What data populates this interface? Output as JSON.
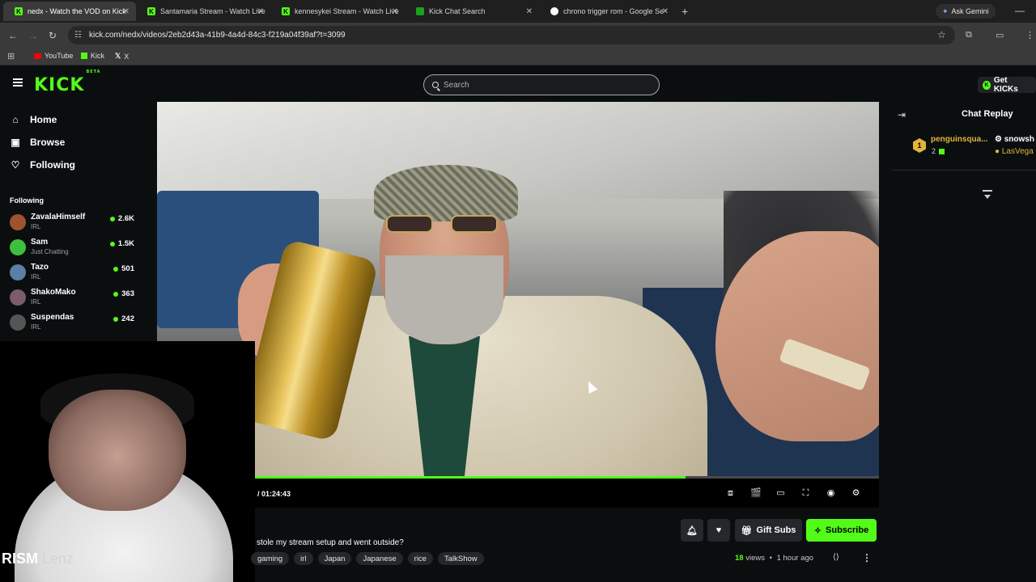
{
  "browser": {
    "tabs": [
      {
        "title": "nedx - Watch the VOD on Kick",
        "icon": "kick-icon"
      },
      {
        "title": "Santamaria Stream - Watch Live",
        "icon": "kick-icon"
      },
      {
        "title": "kennesykei Stream - Watch Live",
        "icon": "kick-icon"
      },
      {
        "title": "Kick Chat Search",
        "icon": "kick-chat-icon"
      },
      {
        "title": "chrono trigger rom - Google Se",
        "icon": "google-icon"
      }
    ],
    "new_tab": "+",
    "ask_gemini": "Ask Gemini",
    "url": "kick.com/nedx/videos/2eb2d43a-41b9-4a4d-84c3-f219a04f39af?t=3099",
    "bookmarks": [
      "YouTube",
      "Kick",
      "X"
    ]
  },
  "header": {
    "logo": "KICK",
    "logo_beta": "BETA",
    "search_placeholder": "Search",
    "get_kicks": "Get KICKs"
  },
  "sidebar": {
    "nav": [
      {
        "label": "Home",
        "icon": "home-icon"
      },
      {
        "label": "Browse",
        "icon": "browse-icon"
      },
      {
        "label": "Following",
        "icon": "heart-icon"
      }
    ],
    "following_title": "Following",
    "following": [
      {
        "name": "ZavalaHimself",
        "category": "IRL",
        "viewers": "2.6K",
        "color": "#a0522d"
      },
      {
        "name": "Sam",
        "category": "Just Chatting",
        "viewers": "1.5K",
        "color": "#3fbf3f"
      },
      {
        "name": "Tazo",
        "category": "IRL",
        "viewers": "501",
        "color": "#5b7fa6"
      },
      {
        "name": "ShakoMako",
        "category": "IRL",
        "viewers": "363",
        "color": "#7a5c6b"
      },
      {
        "name": "Suspendas",
        "category": "IRL",
        "viewers": "242",
        "color": "#555555"
      }
    ]
  },
  "player": {
    "time": "/ 01:24:43",
    "progress": 0.69,
    "accent": "#53fc18"
  },
  "webcam": {
    "logo": "RISM",
    "logo_faded": "Lenz"
  },
  "video_info": {
    "title": "stole my stream setup and went outside?",
    "tags": [
      "gaming",
      "irl",
      "Japan",
      "Japanese",
      "rice",
      "TalkShow"
    ],
    "gift_subs": "Gift Subs",
    "subscribe": "Subscribe",
    "views_count": "18",
    "views_label": "views",
    "separator": "•",
    "time_ago": "1 hour ago"
  },
  "chat": {
    "title": "Chat Replay",
    "messages": [
      {
        "rank": "1",
        "user": "penguinsqua...",
        "count": "2",
        "reply_user": "snowsh",
        "reply_text": "LasVega"
      }
    ]
  }
}
